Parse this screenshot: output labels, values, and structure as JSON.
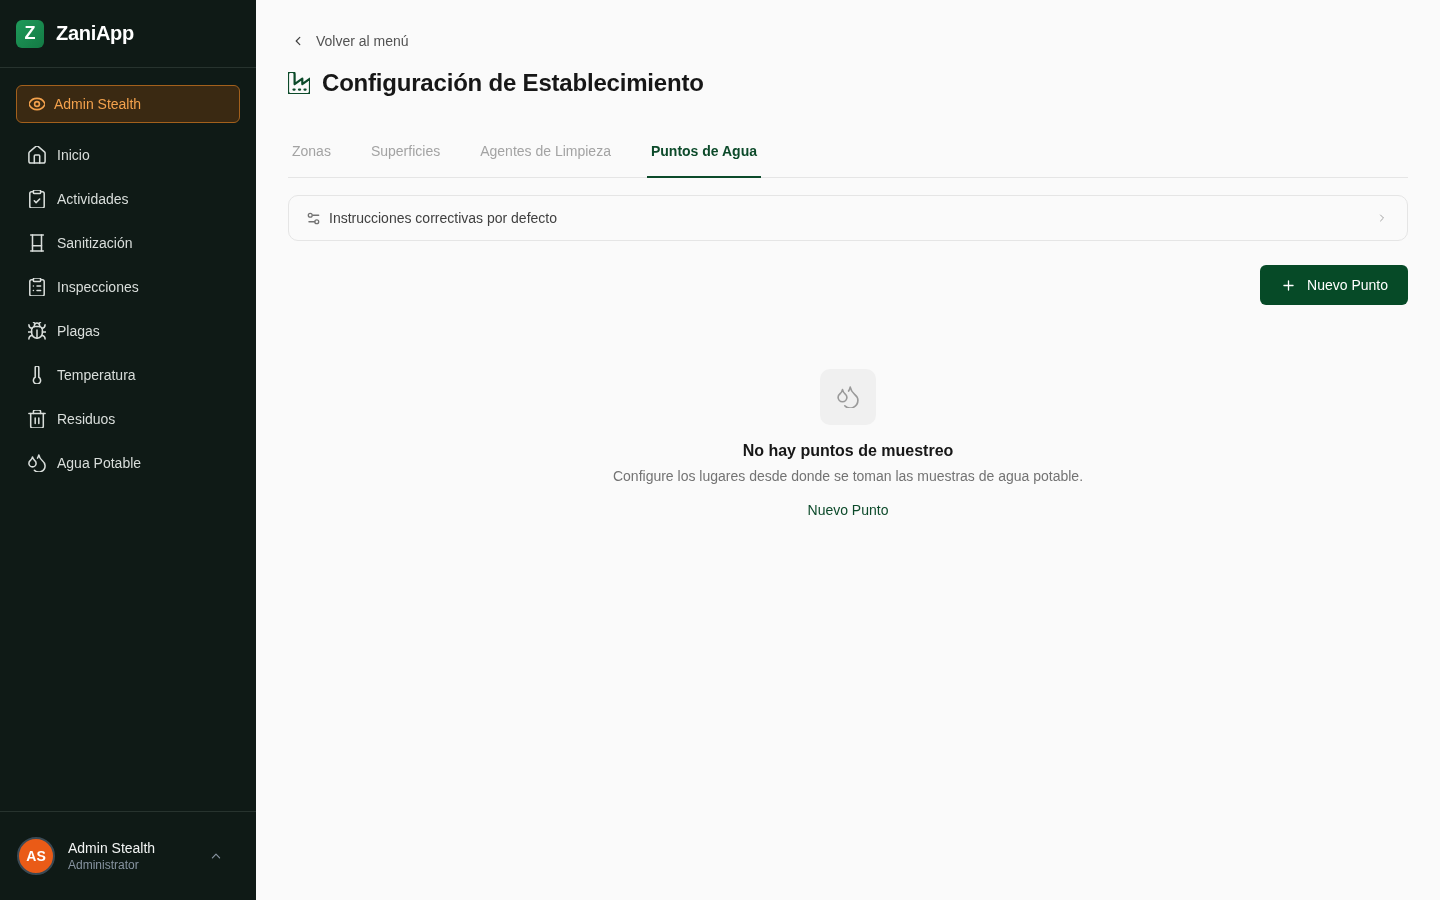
{
  "sidebar": {
    "logo": {
      "letter": "Z",
      "name": "ZaniApp"
    },
    "stealth_badge": "Admin Stealth",
    "items": [
      {
        "label": "Inicio"
      },
      {
        "label": "Actividades"
      },
      {
        "label": "Sanitización"
      },
      {
        "label": "Inspecciones"
      },
      {
        "label": "Plagas"
      },
      {
        "label": "Temperatura"
      },
      {
        "label": "Residuos"
      },
      {
        "label": "Agua Potable"
      }
    ],
    "user": {
      "initials": "AS",
      "name": "Admin Stealth",
      "role": "Administrator"
    }
  },
  "main": {
    "back_link": "Volver al menú",
    "title": "Configuración de Establecimiento",
    "tabs": [
      {
        "label": "Zonas",
        "selected": false
      },
      {
        "label": "Superficies",
        "selected": false
      },
      {
        "label": "Agentes de Limpieza",
        "selected": false
      },
      {
        "label": "Puntos de Agua",
        "selected": true
      }
    ],
    "instructions_row": "Instrucciones correctivas por defecto",
    "new_button": "Nuevo Punto",
    "empty_state": {
      "title": "No hay puntos de muestreo",
      "description": "Configure los lugares desde donde se toman las muestras de agua potable.",
      "action": "Nuevo Punto"
    }
  }
}
